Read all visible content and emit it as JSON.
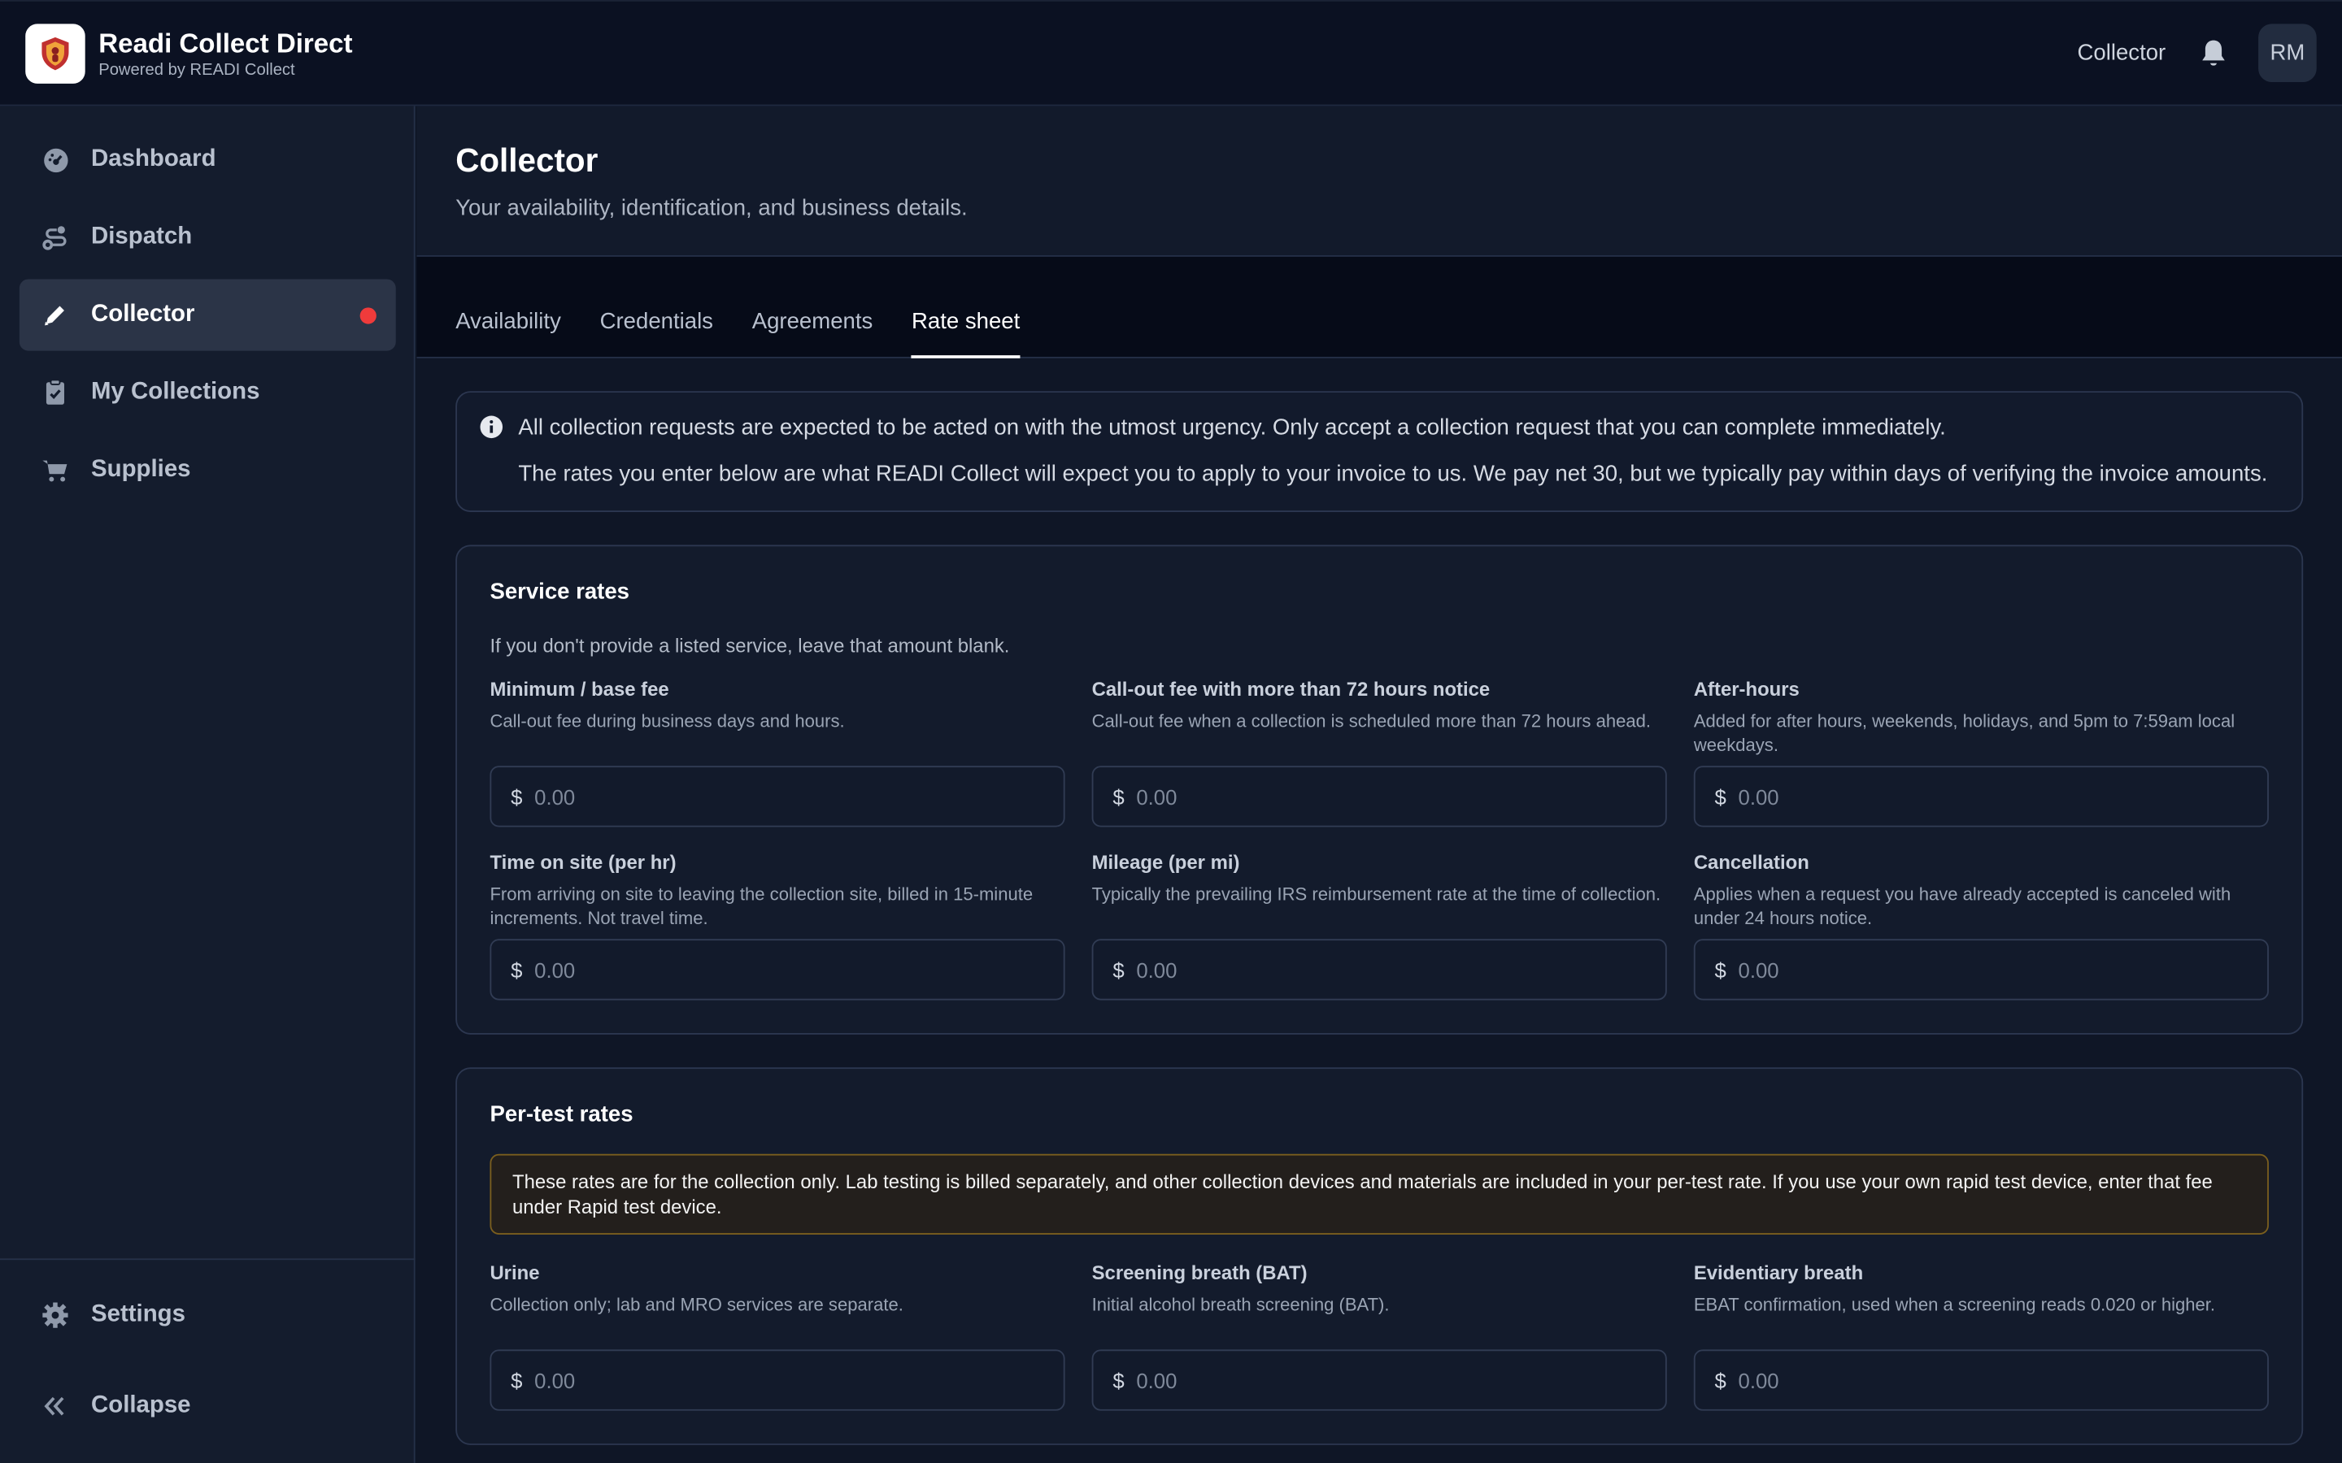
{
  "header": {
    "brand_title": "Readi Collect Direct",
    "brand_sub": "Powered by READI Collect",
    "role": "Collector",
    "avatar_initials": "RM"
  },
  "sidebar": {
    "items": [
      {
        "label": "Dashboard",
        "icon": "dashboard-icon"
      },
      {
        "label": "Dispatch",
        "icon": "dispatch-icon"
      },
      {
        "label": "Collector",
        "icon": "pen-icon",
        "active": true
      },
      {
        "label": "My Collections",
        "icon": "clipboard-icon"
      },
      {
        "label": "Supplies",
        "icon": "cart-icon"
      }
    ],
    "settings_label": "Settings",
    "collapse_label": "Collapse"
  },
  "page": {
    "title": "Collector",
    "subtitle": "Your availability, identification, and business details."
  },
  "tabs": [
    "Availability",
    "Credentials",
    "Agreements",
    "Rate sheet"
  ],
  "active_tab": "Rate sheet",
  "notice": {
    "line1": "All collection requests are expected to be acted on with the utmost urgency. Only accept a collection request that you can complete immediately.",
    "line2": "The rates you enter below are what READI Collect will expect you to apply to your invoice to us. We pay net 30, but we typically pay within days of verifying the invoice amounts."
  },
  "service_rates": {
    "title": "Service rates",
    "description": "If you don't provide a listed service, leave that amount blank.",
    "currency": "$",
    "placeholder": "0.00",
    "fields": [
      {
        "label": "Minimum / base fee",
        "help": "Call-out fee during business days and hours."
      },
      {
        "label": "Call-out fee with more than 72 hours notice",
        "help": "Call-out fee when a collection is scheduled more than 72 hours ahead."
      },
      {
        "label": "After-hours",
        "help": "Added for after hours, weekends, holidays, and 5pm to 7:59am local weekdays."
      },
      {
        "label": "Time on site (per hr)",
        "help": "From arriving on site to leaving the collection site, billed in 15-minute increments. Not travel time."
      },
      {
        "label": "Mileage (per mi)",
        "help": "Typically the prevailing IRS reimbursement rate at the time of collection."
      },
      {
        "label": "Cancellation",
        "help": "Applies when a request you have already accepted is canceled with under 24 hours notice."
      }
    ]
  },
  "per_test_rates": {
    "title": "Per-test rates",
    "warning": "These rates are for the collection only. Lab testing is billed separately, and other collection devices and materials are included in your per-test rate. If you use your own rapid test device, enter that fee under Rapid test device.",
    "currency": "$",
    "placeholder": "0.00",
    "fields": [
      {
        "label": "Urine",
        "help": "Collection only; lab and MRO services are separate."
      },
      {
        "label": "Screening breath (BAT)",
        "help": "Initial alcohol breath screening (BAT)."
      },
      {
        "label": "Evidentiary breath",
        "help": "EBAT confirmation, used when a screening reads 0.020 or higher."
      }
    ]
  },
  "colors": {
    "accent_dot": "#ef3b3b",
    "background": "#0f1626",
    "warning_border": "#7a5e1e"
  }
}
